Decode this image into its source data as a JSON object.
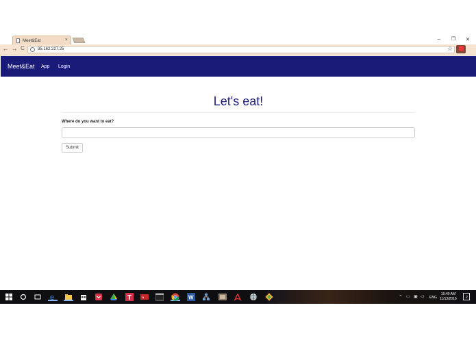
{
  "browser": {
    "tab_title": "Meet&Eat",
    "tab_close": "×",
    "url": "35.162.227.25",
    "window_controls": {
      "minimize": "–",
      "restore": "❐",
      "close": "✕"
    },
    "nav": {
      "back": "←",
      "forward": "→",
      "reload": "C"
    },
    "star": "☆"
  },
  "navbar": {
    "brand": "Meet&Eat",
    "links": [
      "App",
      "Login"
    ],
    "color": "#1a1a78"
  },
  "main": {
    "title": "Let's eat!",
    "prompt_label": "Where do you want to eat?",
    "input_value": "",
    "submit_label": "Submit"
  },
  "taskbar": {
    "icons": [
      "windows-start-icon",
      "search-circle-icon",
      "task-view-icon",
      "edge-icon",
      "file-explorer-icon",
      "store-icon",
      "pocket-icon",
      "drive-icon",
      "t-app-icon",
      "media-app-icon",
      "terminal-icon",
      "chrome-icon",
      "word-icon",
      "network-app-icon",
      "photo-app-icon",
      "acrobat-icon",
      "globe-app-icon",
      "git-icon"
    ],
    "language": "ENG",
    "time": "10:40 AM",
    "date": "11/13/2016",
    "notifications": "2"
  }
}
